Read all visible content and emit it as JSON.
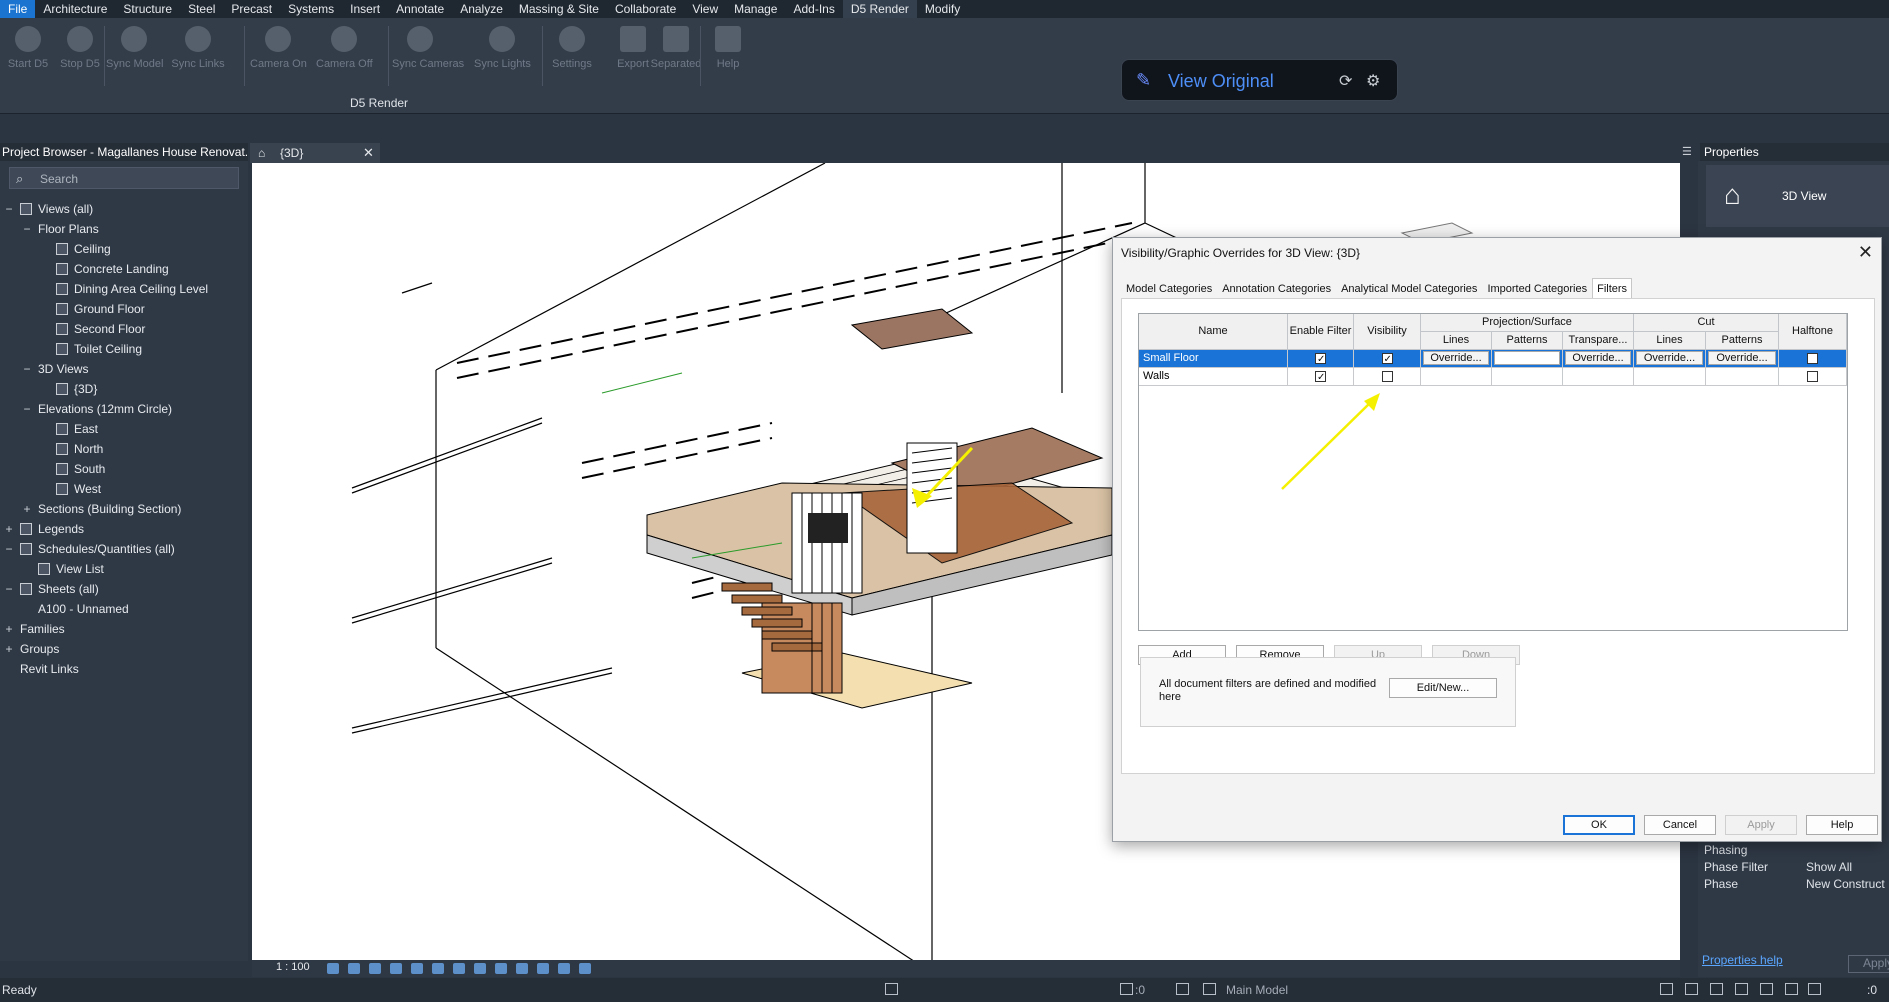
{
  "menu": [
    "File",
    "Architecture",
    "Structure",
    "Steel",
    "Precast",
    "Systems",
    "Insert",
    "Annotate",
    "Analyze",
    "Massing & Site",
    "Collaborate",
    "View",
    "Manage",
    "Add-Ins",
    "D5 Render",
    "Modify"
  ],
  "ribbon": {
    "tools": [
      "Start D5",
      "Stop D5",
      "Sync Model",
      "Sync Links",
      "Camera On",
      "Camera Off",
      "Sync Cameras",
      "Sync Lights",
      "Settings",
      "Export",
      "Separated",
      "Help"
    ],
    "group_label": "D5 Render"
  },
  "view_pill": {
    "text": "View Original"
  },
  "project_browser": {
    "title": "Project Browser - Magallanes House Renovat...",
    "search_placeholder": "Search",
    "items": [
      {
        "label": "Views (all)",
        "level": 0,
        "exp": "−",
        "icon": true
      },
      {
        "label": "Floor Plans",
        "level": 1,
        "exp": "−",
        "icon": false
      },
      {
        "label": "Ceiling",
        "level": 2,
        "exp": "",
        "icon": true
      },
      {
        "label": "Concrete Landing",
        "level": 2,
        "exp": "",
        "icon": true
      },
      {
        "label": "Dining Area Ceiling Level",
        "level": 2,
        "exp": "",
        "icon": true
      },
      {
        "label": "Ground Floor",
        "level": 2,
        "exp": "",
        "icon": true
      },
      {
        "label": "Second Floor",
        "level": 2,
        "exp": "",
        "icon": true
      },
      {
        "label": "Toilet Ceiling",
        "level": 2,
        "exp": "",
        "icon": true
      },
      {
        "label": "3D Views",
        "level": 1,
        "exp": "−",
        "icon": false
      },
      {
        "label": "{3D}",
        "level": 2,
        "exp": "",
        "icon": true
      },
      {
        "label": "Elevations (12mm Circle)",
        "level": 1,
        "exp": "−",
        "icon": false
      },
      {
        "label": "East",
        "level": 2,
        "exp": "",
        "icon": true
      },
      {
        "label": "North",
        "level": 2,
        "exp": "",
        "icon": true
      },
      {
        "label": "South",
        "level": 2,
        "exp": "",
        "icon": true
      },
      {
        "label": "West",
        "level": 2,
        "exp": "",
        "icon": true
      },
      {
        "label": "Sections (Building Section)",
        "level": 1,
        "exp": "+",
        "icon": false
      },
      {
        "label": "Legends",
        "level": 0,
        "exp": "+",
        "icon": true
      },
      {
        "label": "Schedules/Quantities (all)",
        "level": 0,
        "exp": "−",
        "icon": true
      },
      {
        "label": "View List",
        "level": 1,
        "exp": "",
        "icon": true
      },
      {
        "label": "Sheets (all)",
        "level": 0,
        "exp": "−",
        "icon": true
      },
      {
        "label": "A100 - Unnamed",
        "level": 1,
        "exp": "",
        "icon": false
      },
      {
        "label": "Families",
        "level": 0,
        "exp": "+",
        "icon": false
      },
      {
        "label": "Groups",
        "level": 0,
        "exp": "+",
        "icon": false
      },
      {
        "label": "Revit Links",
        "level": 0,
        "exp": "",
        "icon": false
      }
    ]
  },
  "doc_tab": {
    "label": "{3D}"
  },
  "view_status": {
    "scale": "1 : 100"
  },
  "properties": {
    "title": "Properties",
    "type": "3D View",
    "section": "Phasing",
    "rows": [
      {
        "label": "Phase Filter",
        "value": "Show All"
      },
      {
        "label": "Phase",
        "value": "New Construct"
      }
    ],
    "help": "Properties help",
    "apply": "Apply"
  },
  "statusbar": {
    "ready": "Ready",
    "model": "Main Model",
    "zero1": ":0",
    "zero2": ":0"
  },
  "dialog": {
    "title": "Visibility/Graphic Overrides for 3D View: {3D}",
    "tabs": [
      "Model Categories",
      "Annotation Categories",
      "Analytical Model Categories",
      "Imported Categories",
      "Filters"
    ],
    "active_tab": "Filters",
    "headers": {
      "name": "Name",
      "enable": "Enable Filter",
      "visibility": "Visibility",
      "projection": "Projection/Surface",
      "cut": "Cut",
      "halftone": "Halftone",
      "lines": "Lines",
      "patterns": "Patterns",
      "transparency": "Transpare...",
      "cut_lines": "Lines",
      "cut_patterns": "Patterns"
    },
    "rows": [
      {
        "name": "Small Floor",
        "enable": true,
        "visibility": true,
        "override": "Override...",
        "halftone": false,
        "selected": true
      },
      {
        "name": "Walls",
        "enable": true,
        "visibility": false,
        "override": "",
        "halftone": false,
        "selected": false
      }
    ],
    "buttons": {
      "add": "Add",
      "remove": "Remove",
      "up": "Up",
      "down": "Down",
      "edit": "Edit/New...",
      "ok": "OK",
      "cancel": "Cancel",
      "apply": "Apply",
      "help": "Help"
    },
    "info": "All document filters are defined and modified here"
  },
  "colors": {
    "accent": "#1a73d6",
    "arrow": "#f5f000"
  }
}
